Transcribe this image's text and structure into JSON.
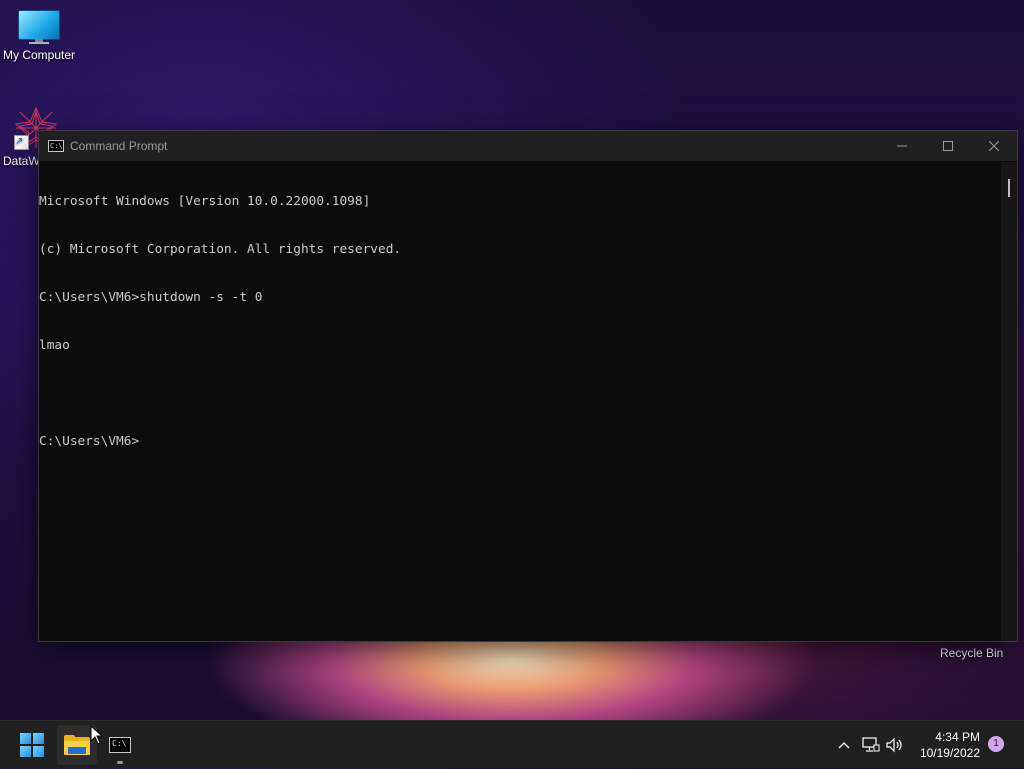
{
  "desktop": {
    "icons": [
      {
        "label": "My Computer",
        "icon": "computer-icon"
      },
      {
        "label": "DataW",
        "icon": "datawatcher-icon"
      }
    ],
    "recycle_bin_label": "Recycle Bin"
  },
  "window": {
    "title": "Command Prompt",
    "icon": "cmd-icon",
    "controls": {
      "minimize": "minimize-icon",
      "maximize": "maximize-icon",
      "close": "close-icon"
    },
    "console_lines": [
      "Microsoft Windows [Version 10.0.22000.1098]",
      "(c) Microsoft Corporation. All rights reserved.",
      "C:\\Users\\VM6>shutdown -s -t 0",
      "lmao",
      "",
      "C:\\Users\\VM6>"
    ]
  },
  "taskbar": {
    "items": [
      {
        "name": "start",
        "icon": "windows-logo-icon"
      },
      {
        "name": "file-explorer",
        "icon": "folder-icon"
      },
      {
        "name": "command-prompt",
        "icon": "cmd-icon"
      }
    ],
    "tray": {
      "chevron_icon": "chevron-up-icon",
      "network_icon": "network-icon",
      "volume_icon": "volume-icon"
    },
    "clock": {
      "time": "4:34 PM",
      "date": "10/19/2022"
    },
    "notification_count": "1"
  },
  "colors": {
    "console_bg": "#0c0c0c",
    "console_text": "#cccccc",
    "taskbar_bg": "#202020",
    "titlebar_bg": "#202020"
  }
}
